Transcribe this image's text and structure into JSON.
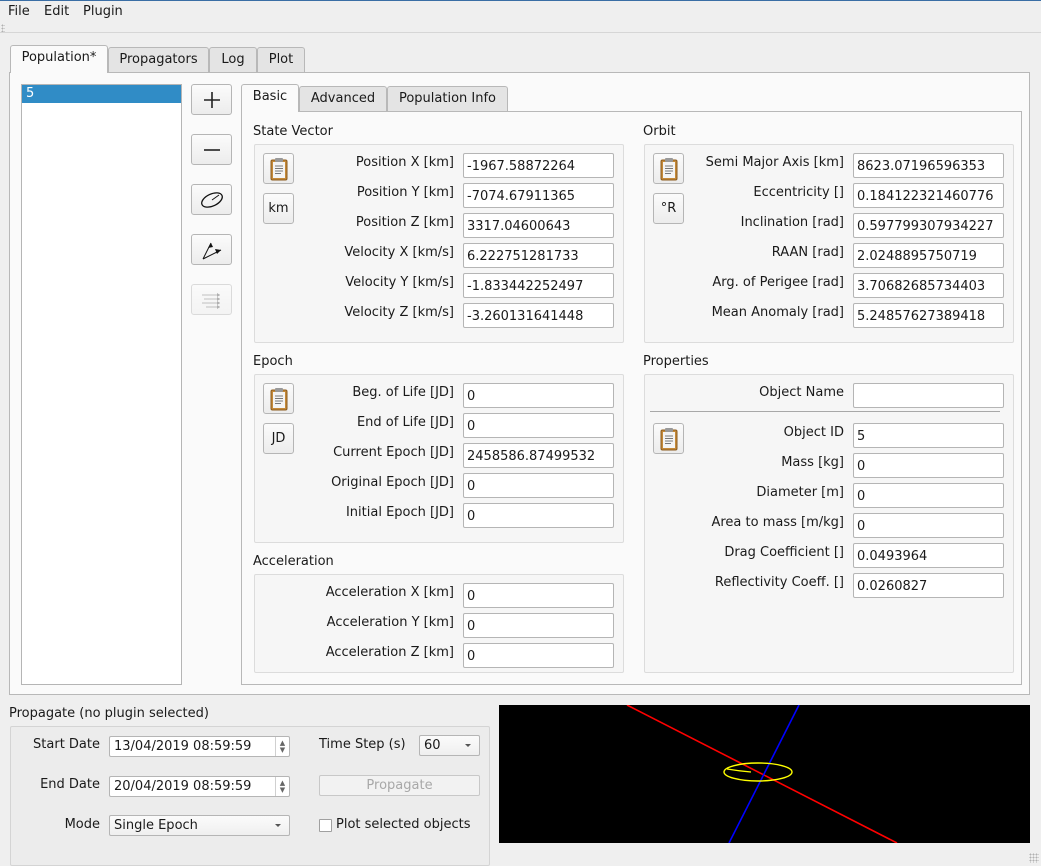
{
  "menu": [
    "File",
    "Edit",
    "Plugin"
  ],
  "main_tabs": [
    {
      "label": "Population*",
      "active": true
    },
    {
      "label": "Propagators",
      "active": false
    },
    {
      "label": "Log",
      "active": false
    },
    {
      "label": "Plot",
      "active": false
    }
  ],
  "population_list": {
    "items": [
      "5"
    ],
    "selected": "5"
  },
  "tool_buttons": [
    {
      "icon": "plus-icon",
      "tooltip": "Add object",
      "enabled": true
    },
    {
      "icon": "minus-icon",
      "tooltip": "Remove object",
      "enabled": true
    },
    {
      "icon": "orbit-ellipse-icon",
      "tooltip": "Orbit",
      "enabled": true
    },
    {
      "icon": "vectors-icon",
      "tooltip": "State vector",
      "enabled": true
    },
    {
      "icon": "multi-arrow-icon",
      "tooltip": "Batch",
      "enabled": false
    }
  ],
  "sub_tabs": [
    {
      "label": "Basic",
      "active": true
    },
    {
      "label": "Advanced",
      "active": false
    },
    {
      "label": "Population Info",
      "active": false
    }
  ],
  "state_vector": {
    "title": "State Vector",
    "unit_button": "km",
    "fields": [
      {
        "label": "Position X [km]",
        "value": "-1967.58872264"
      },
      {
        "label": "Position Y [km]",
        "value": "-7074.67911365"
      },
      {
        "label": "Position Z [km]",
        "value": "3317.04600643"
      },
      {
        "label": "Velocity X [km/s]",
        "value": "6.222751281733"
      },
      {
        "label": "Velocity Y [km/s]",
        "value": "-1.833442252497"
      },
      {
        "label": "Velocity Z [km/s]",
        "value": "-3.260131641448"
      }
    ]
  },
  "orbit": {
    "title": "Orbit",
    "unit_button": "°R",
    "fields": [
      {
        "label": "Semi Major Axis [km]",
        "value": "8623.07196596353"
      },
      {
        "label": "Eccentricity []",
        "value": "0.184122321460776"
      },
      {
        "label": "Inclination [rad]",
        "value": "0.597799307934227"
      },
      {
        "label": "RAAN [rad]",
        "value": "2.0248895750719"
      },
      {
        "label": "Arg. of Perigee [rad]",
        "value": "3.70682685734403"
      },
      {
        "label": "Mean Anomaly [rad]",
        "value": "5.24857627389418"
      }
    ]
  },
  "epoch": {
    "title": "Epoch",
    "unit_button": "JD",
    "fields": [
      {
        "label": "Beg. of Life [JD]",
        "value": "0"
      },
      {
        "label": "End of Life [JD]",
        "value": "0"
      },
      {
        "label": "Current Epoch [JD]",
        "value": "2458586.87499532"
      },
      {
        "label": "Original Epoch [JD]",
        "value": "0"
      },
      {
        "label": "Initial Epoch [JD]",
        "value": "0"
      }
    ]
  },
  "properties": {
    "title": "Properties",
    "object_name": {
      "label": "Object Name",
      "value": ""
    },
    "fields": [
      {
        "label": "Object ID",
        "value": "5"
      },
      {
        "label": "Mass [kg]",
        "value": "0"
      },
      {
        "label": "Diameter [m]",
        "value": "0"
      },
      {
        "label": "Area to mass [m/kg]",
        "value": "0"
      },
      {
        "label": "Drag Coefficient []",
        "value": "0.0493964"
      },
      {
        "label": "Reflectivity Coeff. []",
        "value": "0.0260827"
      }
    ]
  },
  "acceleration": {
    "title": "Acceleration",
    "fields": [
      {
        "label": "Acceleration X [km]",
        "value": "0"
      },
      {
        "label": "Acceleration Y [km]",
        "value": "0"
      },
      {
        "label": "Acceleration Z [km]",
        "value": "0"
      }
    ]
  },
  "propagate": {
    "title": "Propagate (no plugin selected)",
    "start_date_label": "Start Date",
    "start_date": "13/04/2019 08:59:59",
    "end_date_label": "End Date",
    "end_date": "20/04/2019 08:59:59",
    "mode_label": "Mode",
    "mode": "Single Epoch",
    "time_step_label": "Time Step (s)",
    "time_step": "60",
    "propagate_button": "Propagate",
    "propagate_enabled": false,
    "plot_selected_label": "Plot selected objects",
    "plot_selected_checked": false
  },
  "viewport": {
    "background": "#000000",
    "x_axis_color": "#ff0000",
    "z_axis_color": "#0000ff",
    "orbit_color": "#ffff00"
  }
}
